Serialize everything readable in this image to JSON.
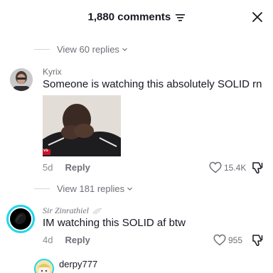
{
  "header": {
    "comment_count": "1,880 comments",
    "filter_icon": "filter-icon",
    "close_icon": "close-icon"
  },
  "thread1": {
    "view_replies": "View 60 replies"
  },
  "comments": [
    {
      "username": "Kyrix",
      "text": "Someone is watching this absolutely SOLID rn",
      "has_image": true,
      "image_badge": "vs",
      "time": "5d",
      "reply_label": "Reply",
      "likes": "15.4K",
      "view_replies": "View 181 replies"
    },
    {
      "username": "Sir Zinrathiel",
      "text": "IM watching this SOLID af btw",
      "time": "4d",
      "reply_label": "Reply",
      "likes": "955"
    },
    {
      "username": "derpy777"
    }
  ],
  "colors": {
    "text": "#161823",
    "secondary": "#6f7077",
    "avatar_ring": "#20d5ec"
  }
}
